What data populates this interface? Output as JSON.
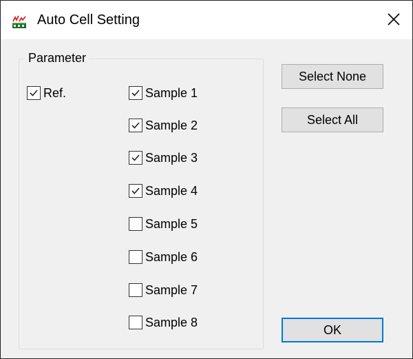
{
  "window": {
    "title": "Auto Cell Setting",
    "icon": "equalizer-app-icon",
    "close_icon": "close-icon"
  },
  "parameter_group": {
    "label": "Parameter",
    "ref": {
      "label": "Ref.",
      "checked": true
    },
    "samples": [
      {
        "label": "Sample 1",
        "checked": true
      },
      {
        "label": "Sample 2",
        "checked": true
      },
      {
        "label": "Sample 3",
        "checked": true
      },
      {
        "label": "Sample 4",
        "checked": true
      },
      {
        "label": "Sample 5",
        "checked": false
      },
      {
        "label": "Sample 6",
        "checked": false
      },
      {
        "label": "Sample 7",
        "checked": false
      },
      {
        "label": "Sample 8",
        "checked": false
      }
    ]
  },
  "buttons": {
    "select_none": "Select None",
    "select_all": "Select All",
    "ok": "OK"
  },
  "colors": {
    "default_button_border": "#0078d7",
    "dialog_background": "#f0f0f0"
  }
}
